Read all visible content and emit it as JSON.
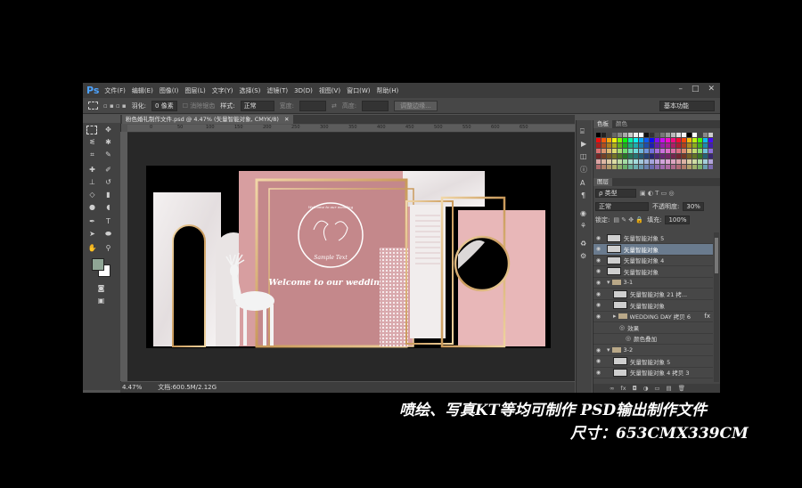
{
  "app": {
    "logo": "Ps",
    "menu": [
      "文件(F)",
      "编辑(E)",
      "图像(I)",
      "图层(L)",
      "文字(Y)",
      "选择(S)",
      "滤镜(T)",
      "3D(D)",
      "视图(V)",
      "窗口(W)",
      "帮助(H)"
    ],
    "window_controls": [
      "–",
      "□",
      "✕"
    ]
  },
  "options_bar": {
    "feather_label": "羽化:",
    "feather_value": "0 像素",
    "antialias_label": "消除锯齿",
    "style_label": "样式:",
    "style_value": "正常",
    "width_label": "宽度:",
    "height_label": "高度:",
    "refine_button": "调整边缘...",
    "workspace": "基本功能"
  },
  "document": {
    "tab_title": "粉色婚礼制作文件.psd @ 4.47% (矢量智能对象, CMYK/8)",
    "close_glyph": "✕",
    "ruler_ticks": [
      "0",
      "50",
      "100",
      "150",
      "200",
      "250",
      "300",
      "350",
      "400",
      "450",
      "500",
      "550",
      "600",
      "650"
    ],
    "zoom": "4.47%",
    "doc_info": "文档:600.5M/2.12G",
    "design_script_top": "Welcome to our wedding",
    "design_monogram": "Sample Text",
    "design_welcome": "Welcome to our wedding"
  },
  "panels": {
    "color_tabs": [
      "色板",
      "颜色"
    ],
    "layers_tab": "图层",
    "kind_label": "ρ 类型",
    "blend_mode": "正常",
    "opacity_label": "不透明度:",
    "opacity_value": "30%",
    "lock_label": "锁定:",
    "fill_label": "填充:",
    "fill_value": "100%",
    "layers": [
      {
        "name": "矢量智能对象 5",
        "type": "smart",
        "indent": 0,
        "selected": false
      },
      {
        "name": "矢量智能对象",
        "type": "smart",
        "indent": 0,
        "selected": true
      },
      {
        "name": "矢量智能对象 4",
        "type": "smart",
        "indent": 0,
        "selected": false
      },
      {
        "name": "矢量智能对象",
        "type": "smart",
        "indent": 0,
        "selected": false
      },
      {
        "name": "3-1",
        "type": "group",
        "indent": 0,
        "selected": false
      },
      {
        "name": "矢量智能对象 21 拷...",
        "type": "smart",
        "indent": 1,
        "selected": false
      },
      {
        "name": "矢量智能对象",
        "type": "smart",
        "indent": 1,
        "selected": false
      },
      {
        "name": "WEDDING DAY 拷贝 6",
        "type": "text",
        "indent": 1,
        "selected": false,
        "fx": "fx"
      },
      {
        "name": "效果",
        "type": "effect",
        "indent": 2,
        "selected": false
      },
      {
        "name": "颜色叠加",
        "type": "effect",
        "indent": 3,
        "selected": false
      },
      {
        "name": "3-2",
        "type": "group",
        "indent": 0,
        "selected": false
      },
      {
        "name": "矢量智能对象 5",
        "type": "smart",
        "indent": 1,
        "selected": false
      },
      {
        "name": "矢量智能对象 4 拷贝 3",
        "type": "smart",
        "indent": 1,
        "selected": false
      }
    ],
    "footer_icons": [
      "∞",
      "fx",
      "◘",
      "◑",
      "▭",
      "▤",
      "🗑"
    ]
  },
  "caption": {
    "line1": "喷绘、写真KT等均可制作 PSD输出制作文件",
    "line2": "尺寸：653CMX339CM"
  },
  "colors": {
    "app_bg": "#535353",
    "menubar": "#3c3c3c",
    "pink": "#c78a8c",
    "gold": "#d9b27a",
    "selected_layer": "#6a7b8e"
  }
}
